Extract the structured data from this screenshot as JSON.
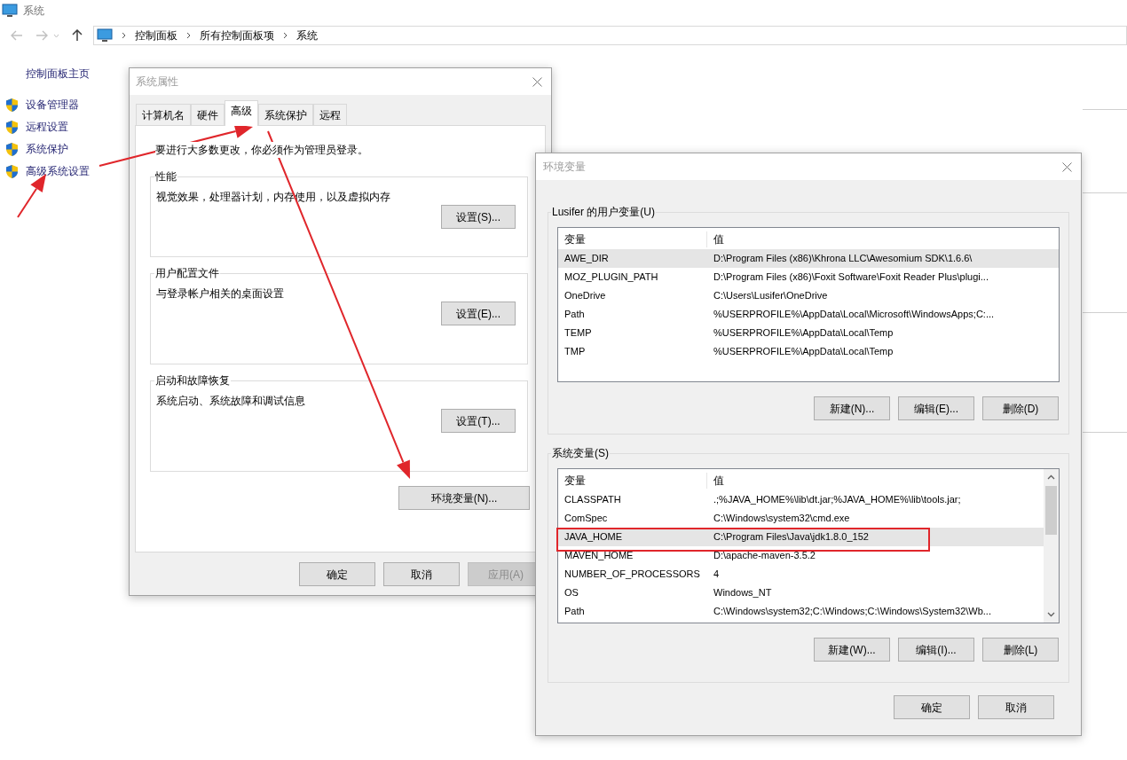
{
  "window": {
    "title": "系统"
  },
  "breadcrumb": [
    "控制面板",
    "所有控制面板项",
    "系统"
  ],
  "sidebar": {
    "home": "控制面板主页",
    "links": [
      "设备管理器",
      "远程设置",
      "系统保护",
      "高级系统设置"
    ]
  },
  "system_properties": {
    "title": "系统属性",
    "tabs": [
      {
        "label": "计算机名",
        "selected": false
      },
      {
        "label": "硬件",
        "selected": false
      },
      {
        "label": "高级",
        "selected": true
      },
      {
        "label": "系统保护",
        "selected": false
      },
      {
        "label": "远程",
        "selected": false
      }
    ],
    "notice": "要进行大多数更改，你必须作为管理员登录。",
    "groups": [
      {
        "title": "性能",
        "description": "视觉效果，处理器计划，内存使用，以及虚拟内存",
        "button": "设置(S)..."
      },
      {
        "title": "用户配置文件",
        "description": "与登录帐户相关的桌面设置",
        "button": "设置(E)..."
      },
      {
        "title": "启动和故障恢复",
        "description": "系统启动、系统故障和调试信息",
        "button": "设置(T)..."
      }
    ],
    "env_button": "环境变量(N)...",
    "buttons": [
      {
        "label": "确定",
        "disabled": false
      },
      {
        "label": "取消",
        "disabled": false
      },
      {
        "label": "应用(A)",
        "disabled": true
      }
    ]
  },
  "env_vars": {
    "title": "环境变量",
    "user_group": {
      "title": "Lusifer 的用户变量(U)",
      "columns": [
        "变量",
        "值"
      ],
      "rows": [
        {
          "name": "AWE_DIR",
          "value": "D:\\Program Files (x86)\\Khrona LLC\\Awesomium SDK\\1.6.6\\",
          "selected": true
        },
        {
          "name": "MOZ_PLUGIN_PATH",
          "value": "D:\\Program Files (x86)\\Foxit Software\\Foxit Reader Plus\\plugi...",
          "selected": false
        },
        {
          "name": "OneDrive",
          "value": "C:\\Users\\Lusifer\\OneDrive",
          "selected": false
        },
        {
          "name": "Path",
          "value": "%USERPROFILE%\\AppData\\Local\\Microsoft\\WindowsApps;C:...",
          "selected": false
        },
        {
          "name": "TEMP",
          "value": "%USERPROFILE%\\AppData\\Local\\Temp",
          "selected": false
        },
        {
          "name": "TMP",
          "value": "%USERPROFILE%\\AppData\\Local\\Temp",
          "selected": false
        }
      ],
      "buttons": [
        "新建(N)...",
        "编辑(E)...",
        "删除(D)"
      ]
    },
    "system_group": {
      "title": "系统变量(S)",
      "columns": [
        "变量",
        "值"
      ],
      "rows": [
        {
          "name": "CLASSPATH",
          "value": ".;%JAVA_HOME%\\lib\\dt.jar;%JAVA_HOME%\\lib\\tools.jar;",
          "selected": false
        },
        {
          "name": "ComSpec",
          "value": "C:\\Windows\\system32\\cmd.exe",
          "selected": false
        },
        {
          "name": "JAVA_HOME",
          "value": "C:\\Program Files\\Java\\jdk1.8.0_152",
          "selected": true
        },
        {
          "name": "MAVEN_HOME",
          "value": "D:\\apache-maven-3.5.2",
          "selected": false
        },
        {
          "name": "NUMBER_OF_PROCESSORS",
          "value": "4",
          "selected": false
        },
        {
          "name": "OS",
          "value": "Windows_NT",
          "selected": false
        },
        {
          "name": "Path",
          "value": "C:\\Windows\\system32;C:\\Windows;C:\\Windows\\System32\\Wb...",
          "selected": false
        }
      ],
      "buttons": [
        "新建(W)...",
        "编辑(I)...",
        "删除(L)"
      ]
    },
    "buttons": [
      "确定",
      "取消"
    ]
  }
}
